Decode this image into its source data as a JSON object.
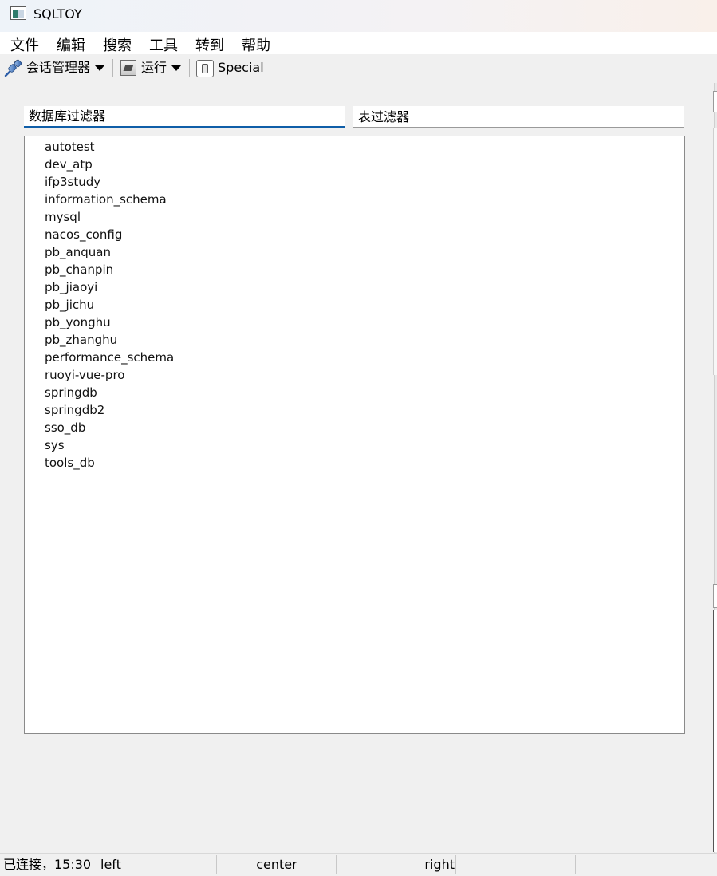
{
  "window": {
    "title": "SQLTOY"
  },
  "menu": {
    "items": [
      "文件",
      "编辑",
      "搜索",
      "工具",
      "转到",
      "帮助"
    ]
  },
  "toolbar": {
    "session_manager_label": "会话管理器",
    "run_label": "运行",
    "special_label": "Special"
  },
  "filters": {
    "database_placeholder": "数据库过滤器",
    "table_placeholder": "表过滤器"
  },
  "databases": [
    "autotest",
    "dev_atp",
    "ifp3study",
    "information_schema",
    "mysql",
    "nacos_config",
    "pb_anquan",
    "pb_chanpin",
    "pb_jiaoyi",
    "pb_jichu",
    "pb_yonghu",
    "pb_zhanghu",
    "performance_schema",
    "ruoyi-vue-pro",
    "springdb",
    "springdb2",
    "sso_db",
    "sys",
    "tools_db"
  ],
  "statusbar": {
    "connection": "已连接，15:30",
    "left": "left",
    "center": "center",
    "right": "right"
  },
  "icons": {
    "app": "app-window-icon",
    "session": "plug-connection-icon",
    "run": "run-icon",
    "special": "special-icon",
    "dropdown": "caret-down-icon"
  },
  "colors": {
    "focus_underline": "#0f5ea8",
    "list_border": "#8a8a8a",
    "background": "#f0f0f0"
  }
}
